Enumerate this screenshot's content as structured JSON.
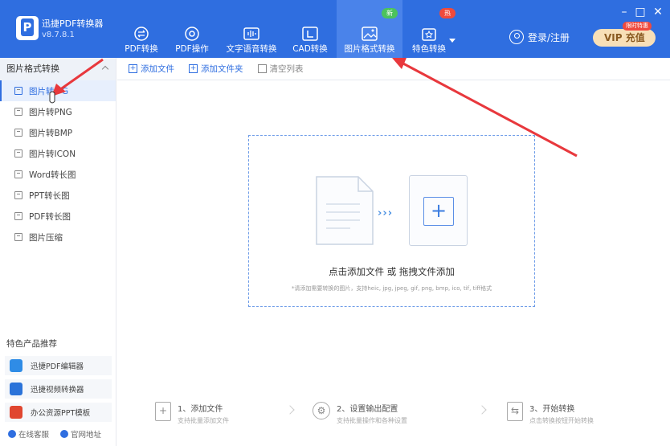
{
  "app": {
    "name": "迅捷PDF转换器",
    "version": "v8.7.8.1"
  },
  "nav": [
    {
      "label": "PDF转换",
      "icon": "pdf-convert-icon"
    },
    {
      "label": "PDF操作",
      "icon": "pdf-operate-icon"
    },
    {
      "label": "文字语音转换",
      "icon": "voice-icon"
    },
    {
      "label": "CAD转换",
      "icon": "cad-icon"
    },
    {
      "label": "图片格式转换",
      "icon": "image-icon",
      "tag": "新"
    },
    {
      "label": "特色转换",
      "icon": "feature-icon",
      "tag": "热"
    }
  ],
  "header": {
    "login_label": "登录/注册",
    "vip_label": "VIP 充值",
    "vip_badge": "限时特惠"
  },
  "sidebar": {
    "title": "图片格式转换",
    "items": [
      {
        "label": "图片转JPG",
        "icon": "jpg-icon",
        "active": true
      },
      {
        "label": "图片转PNG",
        "icon": "png-icon"
      },
      {
        "label": "图片转BMP",
        "icon": "bmp-icon"
      },
      {
        "label": "图片转ICON",
        "icon": "icon-icon"
      },
      {
        "label": "Word转长图",
        "icon": "word-icon"
      },
      {
        "label": "PPT转长图",
        "icon": "ppt-icon"
      },
      {
        "label": "PDF转长图",
        "icon": "pdf-icon"
      },
      {
        "label": "图片压缩",
        "icon": "compress-icon"
      }
    ],
    "promo_title": "特色产品推荐",
    "promos": [
      {
        "label": "迅捷PDF编辑器",
        "color": "#2f8ce6"
      },
      {
        "label": "迅捷视频转换器",
        "color": "#2b73d9"
      },
      {
        "label": "办公资源PPT模板",
        "color": "#e0462f"
      }
    ],
    "links": {
      "service": "在线客服",
      "website": "官网地址"
    }
  },
  "toolbar": {
    "add_file": "添加文件",
    "add_folder": "添加文件夹",
    "clear": "清空列表"
  },
  "dropzone": {
    "main_text": "点击添加文件 或 拖拽文件添加",
    "sub_text": "*请添加需要转换的图片，支持heic, jpg, jpeg, gif, png, bmp, ico, tif, tiff格式"
  },
  "steps": [
    {
      "title": "1、添加文件",
      "desc": "支持批量添加文件"
    },
    {
      "title": "2、设置输出配置",
      "desc": "支持批量操作和各种设置"
    },
    {
      "title": "3、开始转换",
      "desc": "点击转换按钮开始转换"
    }
  ],
  "colors": {
    "brand": "#2f6ee0",
    "annotation": "#e8383d"
  }
}
